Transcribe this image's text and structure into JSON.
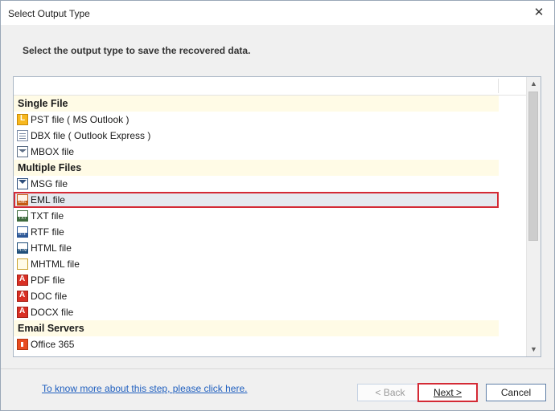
{
  "window": {
    "title": "Select Output Type",
    "close_glyph": "✕"
  },
  "instruction": "Select the output type to save the recovered data.",
  "groups": [
    {
      "label": "Single File",
      "items": [
        {
          "label": "PST file ( MS Outlook )",
          "icon": "pst-file-icon"
        },
        {
          "label": "DBX file ( Outlook Express )",
          "icon": "dbx-file-icon"
        },
        {
          "label": "MBOX file",
          "icon": "mbox-file-icon"
        }
      ]
    },
    {
      "label": "Multiple Files",
      "items": [
        {
          "label": "MSG file",
          "icon": "msg-file-icon"
        },
        {
          "label": "EML file",
          "icon": "eml-file-icon",
          "selected": true
        },
        {
          "label": "TXT file",
          "icon": "txt-file-icon"
        },
        {
          "label": "RTF file",
          "icon": "rtf-file-icon"
        },
        {
          "label": "HTML file",
          "icon": "html-file-icon"
        },
        {
          "label": "MHTML file",
          "icon": "mhtml-file-icon"
        },
        {
          "label": "PDF file",
          "icon": "pdf-file-icon"
        },
        {
          "label": "DOC file",
          "icon": "doc-file-icon"
        },
        {
          "label": "DOCX file",
          "icon": "docx-file-icon"
        }
      ]
    },
    {
      "label": "Email Servers",
      "items": [
        {
          "label": "Office 365",
          "icon": "office365-icon"
        }
      ]
    }
  ],
  "footer": {
    "help_link": "To know more about this step, please click here.",
    "back_label": "< Back",
    "next_label": "Next >",
    "cancel_label": "Cancel"
  },
  "scrollbar": {
    "up_glyph": "▲",
    "down_glyph": "▼"
  },
  "colors": {
    "selection_outline": "#d42a35",
    "group_background": "#fffbe6",
    "link": "#1f5fbf"
  }
}
